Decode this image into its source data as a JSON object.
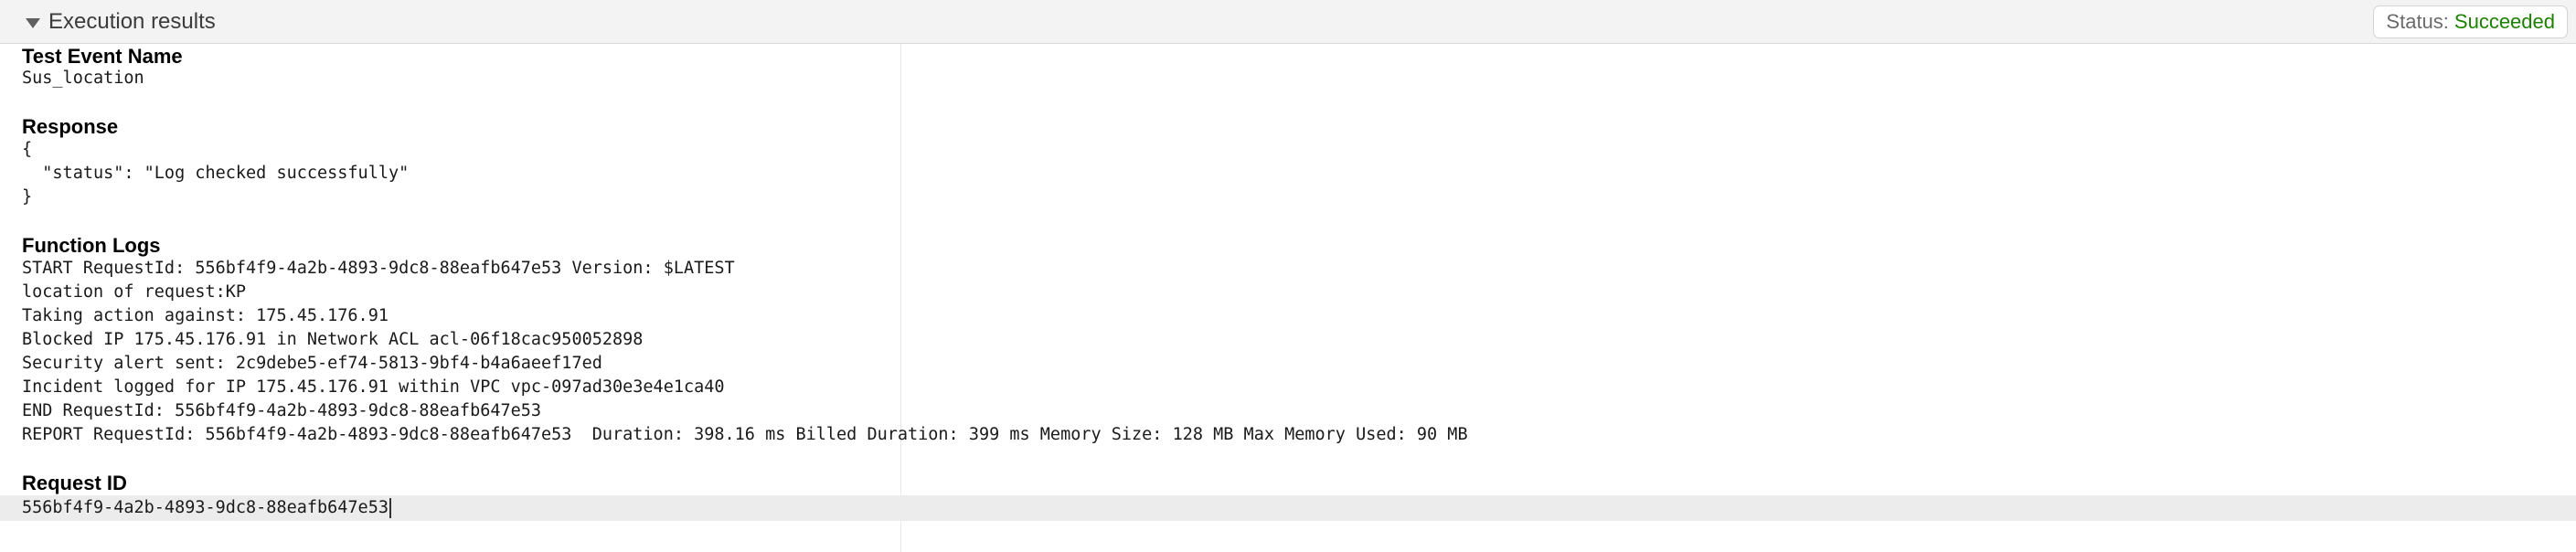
{
  "header": {
    "title": "Execution results",
    "status_label": "Status:",
    "status_value": "Succeeded",
    "status_color": "#1d8102"
  },
  "test_event": {
    "title": "Test Event Name",
    "value": "Sus_location"
  },
  "response": {
    "title": "Response",
    "lines": [
      "{",
      "  \"status\": \"Log checked successfully\"",
      "}"
    ]
  },
  "function_logs": {
    "title": "Function Logs",
    "lines": [
      "START RequestId: 556bf4f9-4a2b-4893-9dc8-88eafb647e53 Version: $LATEST",
      "location of request:KP",
      "Taking action against: 175.45.176.91",
      "Blocked IP 175.45.176.91 in Network ACL acl-06f18cac950052898",
      "Security alert sent: 2c9debe5-ef74-5813-9bf4-b4a6aeef17ed",
      "Incident logged for IP 175.45.176.91 within VPC vpc-097ad30e3e4e1ca40",
      "END RequestId: 556bf4f9-4a2b-4893-9dc8-88eafb647e53",
      "REPORT RequestId: 556bf4f9-4a2b-4893-9dc8-88eafb647e53  Duration: 398.16 ms Billed Duration: 399 ms Memory Size: 128 MB Max Memory Used: 90 MB"
    ]
  },
  "request": {
    "title": "Request ID",
    "value": "556bf4f9-4a2b-4893-9dc8-88eafb647e53"
  },
  "icons": {
    "toggle": "caret-down-icon"
  }
}
